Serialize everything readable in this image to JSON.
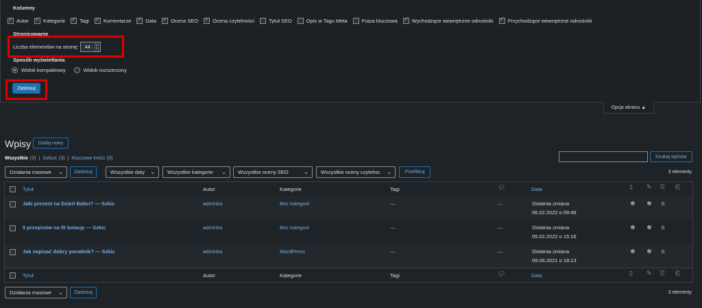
{
  "screen_options": {
    "columns_heading": "Kolumny",
    "columns": [
      {
        "label": "Autor",
        "checked": true
      },
      {
        "label": "Kategorie",
        "checked": true
      },
      {
        "label": "Tagi",
        "checked": true
      },
      {
        "label": "Komentarze",
        "checked": true
      },
      {
        "label": "Data",
        "checked": true
      },
      {
        "label": "Ocena SEO",
        "checked": true
      },
      {
        "label": "Ocena czytelności",
        "checked": true
      },
      {
        "label": "Tytuł SEO",
        "checked": false
      },
      {
        "label": "Opis w Tagu Meta",
        "checked": false
      },
      {
        "label": "Fraza kluczowa",
        "checked": false
      },
      {
        "label": "Wychodzące wewnętrzne odnośniki",
        "checked": true
      },
      {
        "label": "Przychodzące wewnętrzne odnośniki",
        "checked": true
      }
    ],
    "pagination_heading": "Stronicowanie",
    "per_page_label": "Liczba elementów na stronę:",
    "per_page_value": "44",
    "display_heading": "Sposób wyświetlania",
    "view_compact": "Widok kompaktowy",
    "view_extended": "Widok rozszerzony",
    "apply_label": "Zastosuj",
    "tab_label": "Opcje ekranu ▲"
  },
  "page": {
    "title": "Wpisy",
    "add_new": "Dodaj nowy",
    "filter_all": "Wszystkie",
    "filter_all_count": "(3)",
    "filter_drafts": "Szkice",
    "filter_drafts_count": "(3)",
    "filter_cornerstone": "Kluczowe treści",
    "filter_cornerstone_count": "(0)",
    "search_button": "Szukaj wpisów",
    "bulk_actions": "Działania masowe",
    "apply": "Zastosuj",
    "all_dates": "Wszystkie daty",
    "all_categories": "Wszystkie kategorie",
    "all_seo": "Wszystkie oceny SEO",
    "all_readability": "Wszystkie oceny czytelno:",
    "filter_button": "Przefiltruj",
    "items_count": "3 elementy"
  },
  "table": {
    "headers": {
      "title": "Tytuł",
      "author": "Autor",
      "categories": "Kategorie",
      "tags": "Tagi",
      "date": "Data"
    },
    "rows": [
      {
        "title": "Jaki prezent na Dzień Babci? — Szkic",
        "author": "adminka",
        "category": "Bez kategorii",
        "tags": "—",
        "comments": "—",
        "date_label": "Ostatnia zmiana",
        "date": "06.02.2022 o 09:46",
        "links_out": "0"
      },
      {
        "title": "5 przepisów na fit kolację — Szkic",
        "author": "adminka",
        "category": "Bez kategorii",
        "tags": "—",
        "comments": "—",
        "date_label": "Ostatnia zmiana",
        "date": "05.02.2022 o 15:16",
        "links_out": "0"
      },
      {
        "title": "Jak napisać dobry poradnik? — Szkic",
        "author": "adminka",
        "category": "WordPress",
        "tags": "—",
        "comments": "—",
        "date_label": "Ostatnia zmiana",
        "date": "09.06.2021 o 18:13",
        "links_out": "0"
      }
    ]
  },
  "colors": {
    "accent": "#2271b1",
    "link": "#72aee6",
    "highlight": "#e00000"
  }
}
